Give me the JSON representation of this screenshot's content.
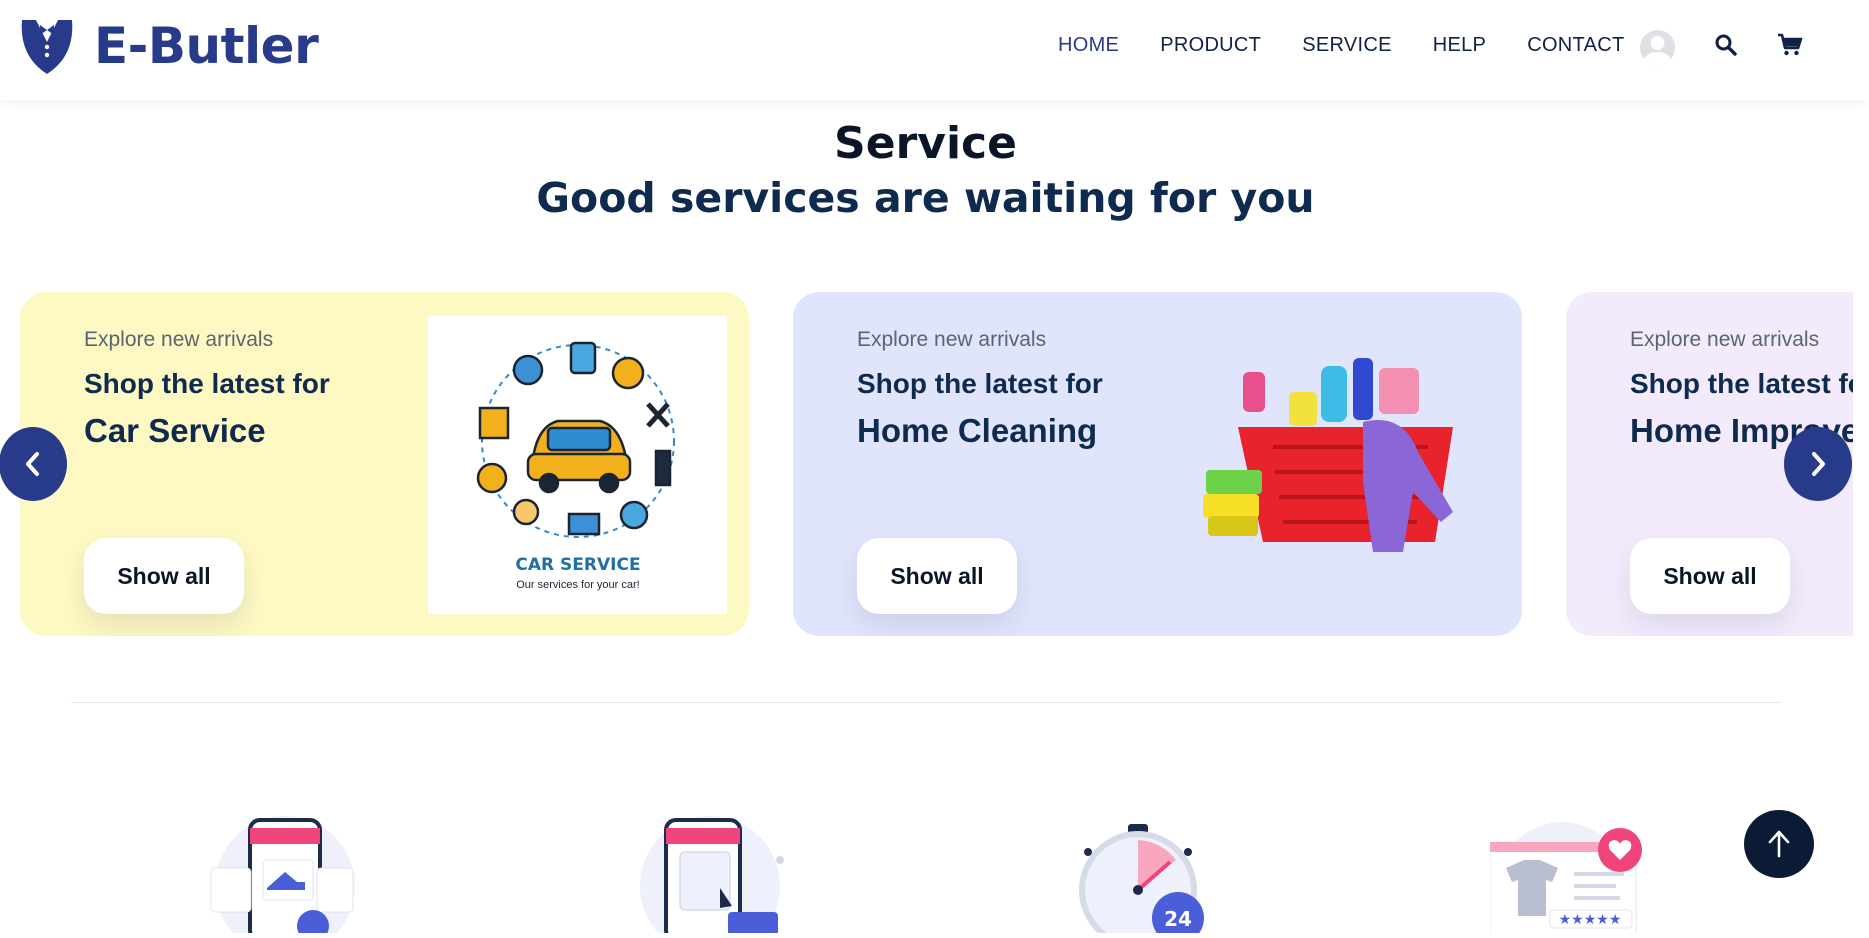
{
  "brand": {
    "name": "E-Butler",
    "accent": "#283a8a"
  },
  "nav": {
    "items": [
      "HOME",
      "PRODUCT",
      "SERVICE",
      "HELP",
      "CONTACT"
    ],
    "active": "HOME"
  },
  "header_icons": [
    "avatar-icon",
    "search-icon",
    "cart-icon"
  ],
  "section": {
    "title": "Service",
    "subtitle": "Good services are waiting for you"
  },
  "cards": [
    {
      "eyebrow": "Explore new arrivals",
      "lead": "Shop the latest for",
      "category": "Car Service",
      "button": "Show all",
      "background": "#fef8c2",
      "image": {
        "title": "CAR SERVICE",
        "caption": "Our services for your car!"
      }
    },
    {
      "eyebrow": "Explore new arrivals",
      "lead": "Shop the latest for",
      "category": "Home Cleaning",
      "button": "Show all",
      "background": "#e0e5fb"
    },
    {
      "eyebrow": "Explore new arrivals",
      "lead": "Shop the latest fo",
      "category": "Home Improvem",
      "button": "Show all",
      "background": "#f3ebfc"
    }
  ],
  "carousel_controls": [
    "chevron-left-icon",
    "chevron-right-icon"
  ],
  "features": [
    "online-shop-icon",
    "mobile-order-icon",
    "delivery-24h-icon",
    "wishlist-icon"
  ],
  "scroll_top": "arrow-up-icon"
}
